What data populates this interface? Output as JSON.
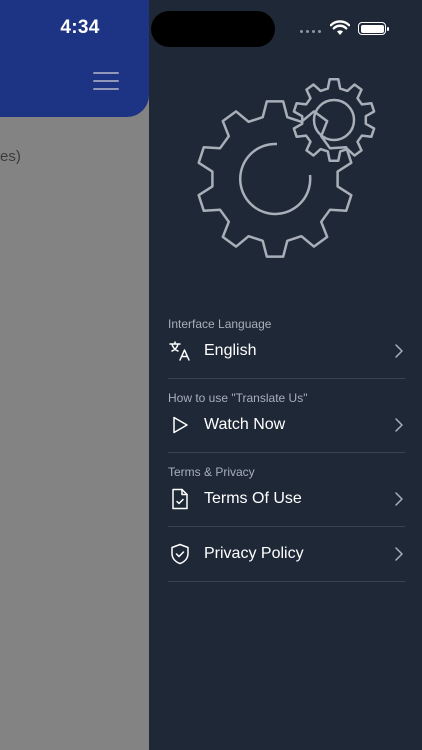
{
  "status_bar": {
    "time": "4:34"
  },
  "main": {
    "partial_text": "es)"
  },
  "drawer": {
    "sections": [
      {
        "label": "Interface Language",
        "item": "English",
        "icon": "translate-icon"
      },
      {
        "label": "How to use \"Translate Us\"",
        "item": "Watch Now",
        "icon": "play-icon"
      },
      {
        "label": "Terms & Privacy",
        "item": "Terms Of Use",
        "icon": "document-check-icon"
      },
      {
        "label": "",
        "item": "Privacy Policy",
        "icon": "shield-check-icon"
      }
    ]
  },
  "colors": {
    "drawer_bg": "#1f2836",
    "header_blue": "#1c3483",
    "dim_overlay": "#838383"
  }
}
